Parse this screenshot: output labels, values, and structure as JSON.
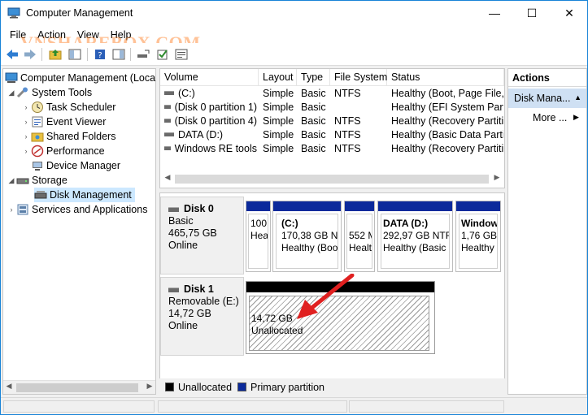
{
  "window": {
    "title": "Computer Management",
    "controls": {
      "minimize": "—",
      "maximize": "☐",
      "close": "✕"
    }
  },
  "watermark": "VNSHAREBOX.COM",
  "menu": [
    "File",
    "Action",
    "View",
    "Help"
  ],
  "tree": {
    "root": "Computer Management (Local",
    "items": [
      {
        "label": "System Tools",
        "level": 1,
        "expanded": true,
        "icon": "tools-icon"
      },
      {
        "label": "Task Scheduler",
        "level": 2,
        "icon": "clock-icon"
      },
      {
        "label": "Event Viewer",
        "level": 2,
        "icon": "event-viewer-icon"
      },
      {
        "label": "Shared Folders",
        "level": 2,
        "icon": "shared-folder-icon"
      },
      {
        "label": "Performance",
        "level": 2,
        "icon": "performance-icon"
      },
      {
        "label": "Device Manager",
        "level": 2,
        "icon": "device-manager-icon"
      },
      {
        "label": "Storage",
        "level": 1,
        "expanded": true,
        "icon": "storage-icon"
      },
      {
        "label": "Disk Management",
        "level": 2,
        "selected": true,
        "icon": "disk-icon"
      },
      {
        "label": "Services and Applications",
        "level": 1,
        "expanded": false,
        "icon": "services-icon"
      }
    ]
  },
  "volume_list": {
    "columns": [
      "Volume",
      "Layout",
      "Type",
      "File System",
      "Status"
    ],
    "rows": [
      [
        "(C:)",
        "Simple",
        "Basic",
        "NTFS",
        "Healthy (Boot, Page File, C"
      ],
      [
        "(Disk 0 partition 1)",
        "Simple",
        "Basic",
        "",
        "Healthy (EFI System Partiti"
      ],
      [
        "(Disk 0 partition 4)",
        "Simple",
        "Basic",
        "NTFS",
        "Healthy (Recovery Partitio"
      ],
      [
        "DATA (D:)",
        "Simple",
        "Basic",
        "NTFS",
        "Healthy (Basic Data Partiti"
      ],
      [
        "Windows RE tools",
        "Simple",
        "Basic",
        "NTFS",
        "Healthy (Recovery Partitio"
      ]
    ]
  },
  "disks": [
    {
      "name": "Disk 0",
      "type": "Basic",
      "size": "465,75 GB",
      "status": "Online",
      "partitions": [
        {
          "name": "",
          "line1": "100",
          "line2": "Hea"
        },
        {
          "name": "(C:)",
          "line1": "170,38 GB NTF",
          "line2": "Healthy (Boot"
        },
        {
          "name": "",
          "line1": "552 M",
          "line2": "Healt"
        },
        {
          "name": "DATA  (D:)",
          "line1": "292,97 GB NTF",
          "line2": "Healthy (Basic"
        },
        {
          "name": "Window",
          "line1": "1,76 GB",
          "line2": "Healthy"
        }
      ]
    },
    {
      "name": "Disk 1",
      "type": "Removable (E:)",
      "size": "14,72 GB",
      "status": "Online",
      "partitions": [
        {
          "name": "",
          "line1": "14,72 GB",
          "line2": "Unallocated"
        }
      ]
    }
  ],
  "legend": [
    {
      "label": "Unallocated",
      "color": "#000000"
    },
    {
      "label": "Primary partition",
      "color": "#0b2a9b"
    }
  ],
  "actions": {
    "header": "Actions",
    "section": "Disk Mana...",
    "more": "More ..."
  },
  "colors": {
    "accent": "#1883d7",
    "partition_bar": "#0b2a9b",
    "selection": "#cce8ff",
    "arrow": "#e02020"
  }
}
